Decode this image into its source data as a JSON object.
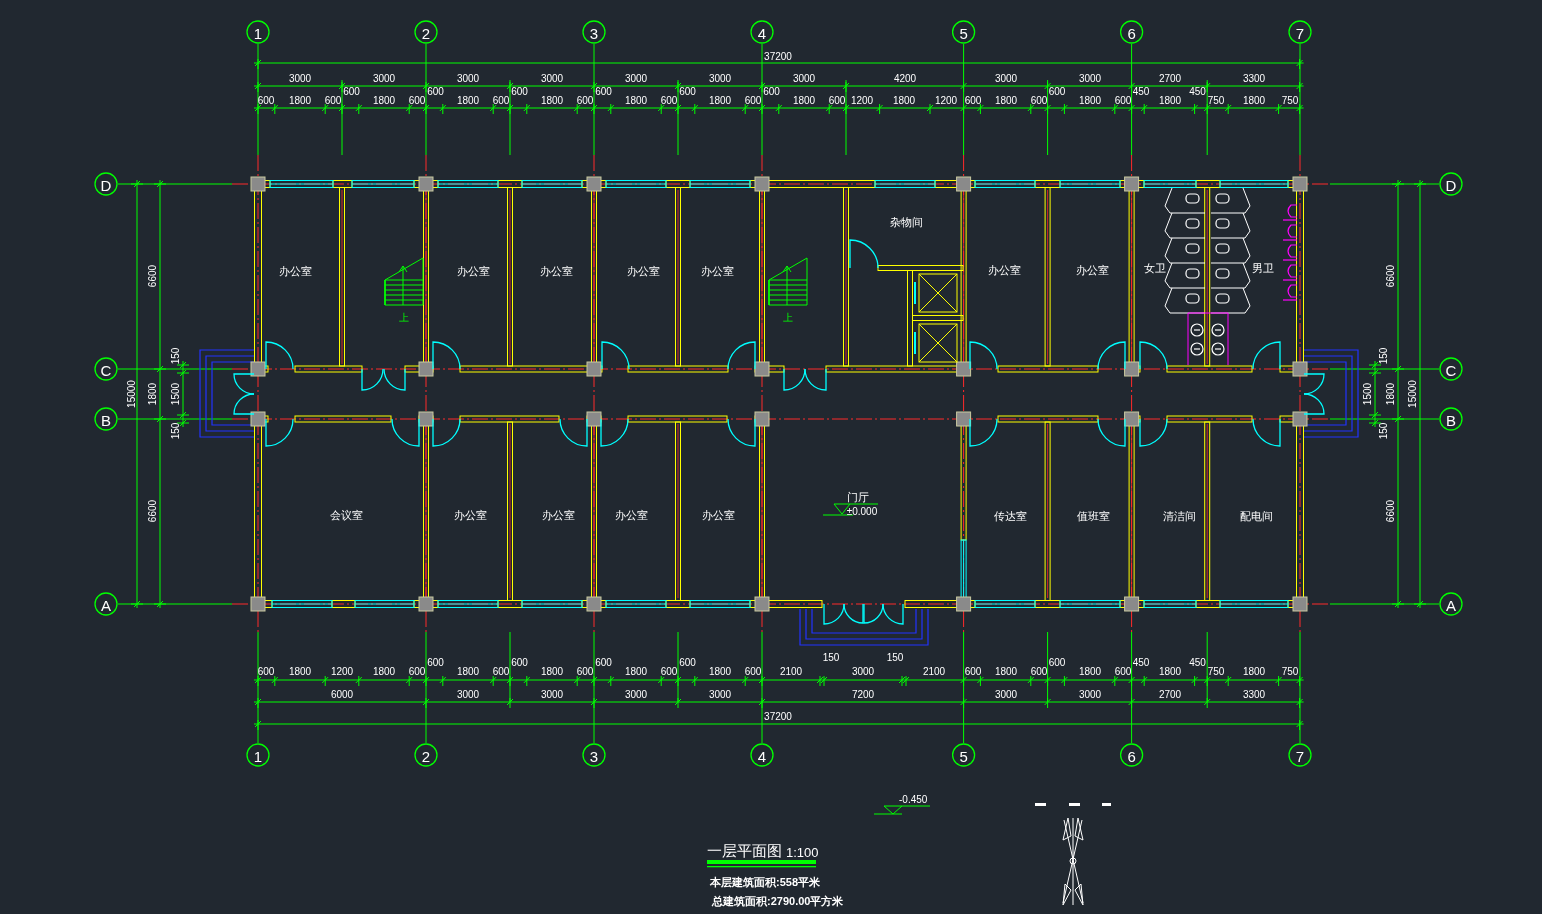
{
  "column_axes_top": [
    {
      "label": "1"
    },
    {
      "label": "2"
    },
    {
      "label": "3"
    },
    {
      "label": "4"
    },
    {
      "label": "5"
    },
    {
      "label": "6"
    },
    {
      "label": "7"
    }
  ],
  "top_dimensions": {
    "overall": "37200",
    "bays": [
      "3000",
      "3000",
      "3000",
      "3000",
      "3000",
      "3000",
      "3000",
      "4200",
      "3000",
      "3000",
      "2700",
      "3300"
    ],
    "details": [
      "600",
      "1800",
      "600",
      "600",
      "1800",
      "600",
      "600",
      "1800",
      "600",
      "600",
      "1800",
      "600",
      "600",
      "1800",
      "600",
      "600",
      "1800",
      "600",
      "600",
      "1800",
      "600",
      "1200",
      "1800",
      "1200",
      "600",
      "1800",
      "600",
      "600",
      "1800",
      "600",
      "450",
      "1800",
      "450",
      "750",
      "1800",
      "750"
    ]
  },
  "row_axes_left": [
    {
      "label": "D"
    },
    {
      "label": "C"
    },
    {
      "label": "B"
    },
    {
      "label": "A"
    }
  ],
  "left_dimensions": {
    "overall": "15000",
    "spans": [
      "6600",
      "1800",
      "6600"
    ],
    "corridor": [
      "150",
      "1500",
      "150"
    ]
  },
  "rooms": [
    {
      "name": "办公室"
    },
    {
      "name": "办公室"
    },
    {
      "name": "办公室"
    },
    {
      "name": "办公室"
    },
    {
      "name": "办公室"
    },
    {
      "name": "杂物间"
    },
    {
      "name": "办公室"
    },
    {
      "name": "办公室"
    },
    {
      "name": "女卫"
    },
    {
      "name": "男卫"
    },
    {
      "name": "会议室"
    },
    {
      "name": "办公室"
    },
    {
      "name": "办公室"
    },
    {
      "name": "办公室"
    },
    {
      "name": "办公室"
    },
    {
      "name": "门厅"
    },
    {
      "name": "传达室"
    },
    {
      "name": "值班室"
    },
    {
      "name": "清洁间"
    },
    {
      "name": "配电间"
    }
  ],
  "stairs": [
    {
      "direction": "上"
    },
    {
      "direction": "上"
    }
  ],
  "lobby_elevation": "±0.000",
  "row_axes_right": [
    {
      "label": "D"
    },
    {
      "label": "C"
    },
    {
      "label": "B"
    },
    {
      "label": "A"
    }
  ],
  "right_dimensions": {
    "overall": "15000",
    "spans": [
      "6600",
      "1800",
      "6600"
    ],
    "corridor": [
      "150",
      "1500",
      "150"
    ]
  },
  "bottom_dimensions": {
    "details": [
      "600",
      "1800",
      "1200",
      "1800",
      "600",
      "600",
      "1800",
      "600",
      "600",
      "1800",
      "600",
      "600",
      "1800",
      "600",
      "600",
      "1800",
      "600",
      "2100",
      "150",
      "3000",
      "150",
      "2100",
      "600",
      "1800",
      "600",
      "600",
      "1800",
      "600",
      "450",
      "1800",
      "450",
      "750",
      "1800",
      "750"
    ],
    "bays": [
      "6000",
      "3000",
      "3000",
      "3000",
      "3000",
      "7200",
      "3000",
      "3000",
      "2700",
      "3300"
    ],
    "overall": "37200"
  },
  "column_axes_bottom": [
    {
      "label": "1"
    },
    {
      "label": "2"
    },
    {
      "label": "3"
    },
    {
      "label": "4"
    },
    {
      "label": "5"
    },
    {
      "label": "6"
    },
    {
      "label": "7"
    }
  ],
  "exterior_elevation": "-0.450",
  "title": {
    "name": "一层平面图",
    "scale": "1:100"
  },
  "notes": [
    "本层建筑面积:558平米",
    "总建筑面积:2790.00平方米"
  ]
}
